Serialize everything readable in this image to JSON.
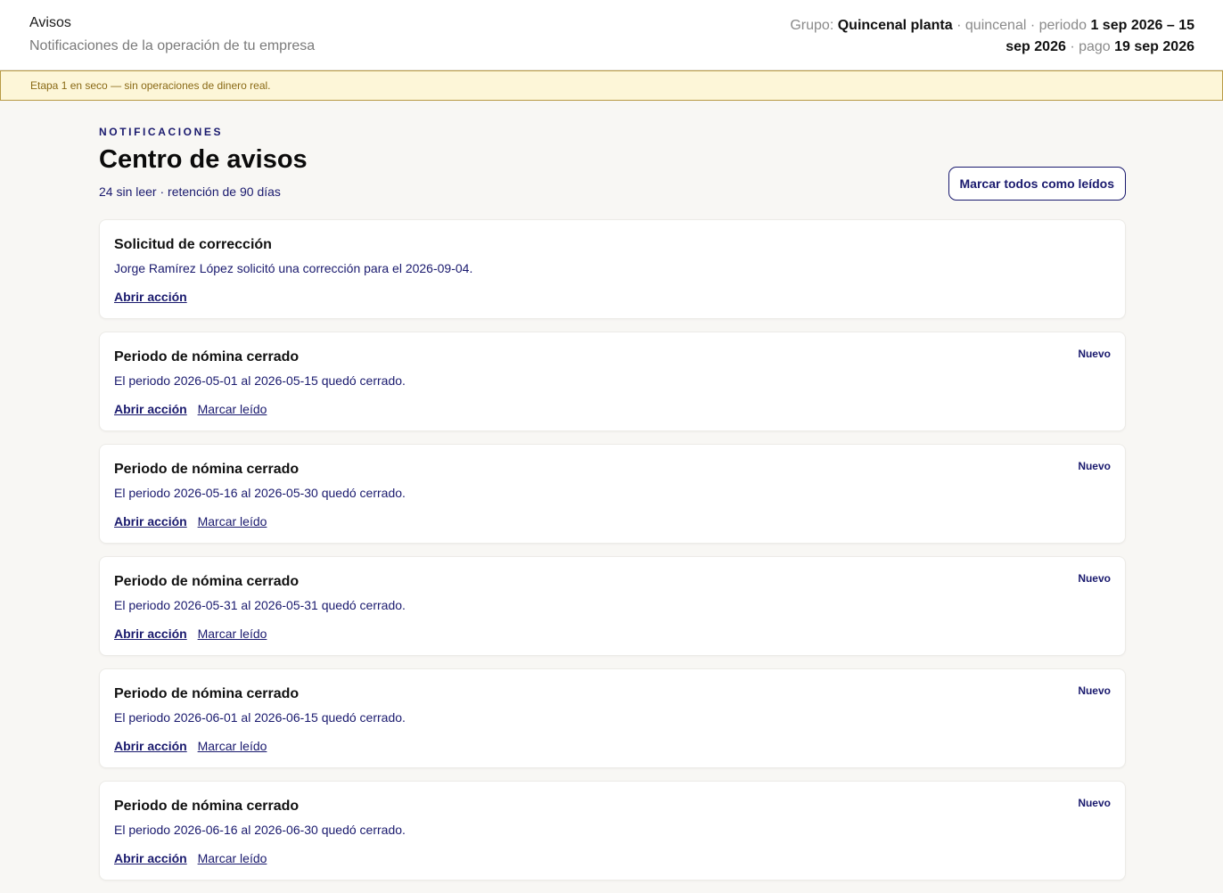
{
  "header": {
    "title": "Avisos",
    "subtitle": "Notificaciones de la operación de tu empresa",
    "group_label": "Grupo:",
    "group_name": "Quincenal planta",
    "frequency": "quincenal",
    "period_label": "periodo",
    "period_value": "1 sep 2026 – 15 sep 2026",
    "pay_label": "pago",
    "pay_value": "19 sep 2026"
  },
  "banner": {
    "text": "Etapa 1 en seco — sin operaciones de dinero real."
  },
  "main": {
    "eyebrow": "NOTIFICACIONES",
    "title": "Centro de avisos",
    "meta": "24 sin leer · retención de 90 días",
    "mark_all_label": "Marcar todos como leídos"
  },
  "notifications": [
    {
      "title": "Solicitud de corrección",
      "body": "Jorge Ramírez López solicitó una corrección para el 2026-09-04.",
      "badge": "",
      "action_open": "Abrir acción",
      "action_read": ""
    },
    {
      "title": "Periodo de nómina cerrado",
      "body": "El periodo 2026-05-01 al 2026-05-15 quedó cerrado.",
      "badge": "Nuevo",
      "action_open": "Abrir acción",
      "action_read": "Marcar leído"
    },
    {
      "title": "Periodo de nómina cerrado",
      "body": "El periodo 2026-05-16 al 2026-05-30 quedó cerrado.",
      "badge": "Nuevo",
      "action_open": "Abrir acción",
      "action_read": "Marcar leído"
    },
    {
      "title": "Periodo de nómina cerrado",
      "body": "El periodo 2026-05-31 al 2026-05-31 quedó cerrado.",
      "badge": "Nuevo",
      "action_open": "Abrir acción",
      "action_read": "Marcar leído"
    },
    {
      "title": "Periodo de nómina cerrado",
      "body": "El periodo 2026-06-01 al 2026-06-15 quedó cerrado.",
      "badge": "Nuevo",
      "action_open": "Abrir acción",
      "action_read": "Marcar leído"
    },
    {
      "title": "Periodo de nómina cerrado",
      "body": "El periodo 2026-06-16 al 2026-06-30 quedó cerrado.",
      "badge": "Nuevo",
      "action_open": "Abrir acción",
      "action_read": "Marcar leído"
    }
  ],
  "colors": {
    "accent": "#1a1a6e",
    "banner_bg": "#fdf6d8",
    "banner_border": "#b89a45",
    "banner_text": "#8a6a16",
    "page_bg": "#f8f7f4"
  }
}
